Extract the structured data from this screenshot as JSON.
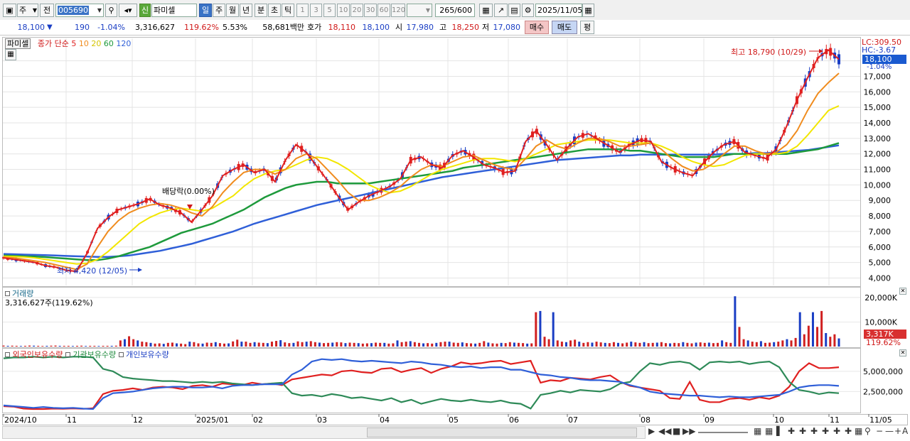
{
  "toolbar": {
    "period_selector": "주",
    "prev_label": "전",
    "code": "005690",
    "credit_badge": "신",
    "stock_name": "파미셀",
    "periods": [
      "일",
      "주",
      "월",
      "년",
      "분",
      "초",
      "틱"
    ],
    "active_period": "일",
    "intervals": [
      "1",
      "3",
      "5",
      "10",
      "20",
      "30",
      "60",
      "120"
    ],
    "count": "265",
    "count_max": "/600",
    "date": "2025/11/05"
  },
  "quote": {
    "price": "18,100",
    "change_arrow": "▼",
    "change": "190",
    "change_pct": "-1.04%",
    "volume": "3,316,627",
    "volume_ratio": "119.62%",
    "turnover_rate": "5.53%",
    "amount": "58,681백만",
    "ask_label": "호가",
    "ask": "18,110",
    "bid": "18,100",
    "open_label": "시",
    "open": "17,980",
    "high_label": "고",
    "high": "18,250",
    "low_label": "저",
    "low": "17,080",
    "buy_label": "매수",
    "sell_label": "매도",
    "eval_label": "평"
  },
  "price_pane": {
    "name_tag": "파미셀",
    "legend_prefix": "종가 단순",
    "ma_items": [
      {
        "label": "5",
        "color": "#e02020"
      },
      {
        "label": "10",
        "color": "#f08c1e"
      },
      {
        "label": "20",
        "color": "#f0e000"
      },
      {
        "label": "60",
        "color": "#1e9a3c"
      },
      {
        "label": "120",
        "color": "#2f5fd8"
      }
    ],
    "max_label": "최고 18,790 (10/29)",
    "min_label": "최저 4,420 (12/05)",
    "dividend_label": "배당락(0.00%)",
    "lc": "LC:309.50",
    "hc": "HC:-3.67",
    "price_box": "18,100",
    "price_box_pct": "-1.04%"
  },
  "volume_pane": {
    "title": "거래량",
    "value": "3,316,627주(119.62%)",
    "box": "3,317K",
    "box_pct": "119.62%"
  },
  "holdings_pane": {
    "items": [
      "외국인보유수량",
      "기관보유수량",
      "개인보유수량"
    ]
  },
  "chart_data": [
    {
      "type": "line",
      "title": "파미셀",
      "y_ticks": [
        4000,
        5000,
        6000,
        7000,
        8000,
        9000,
        10000,
        11000,
        12000,
        13000,
        14000,
        15000,
        16000,
        17000,
        18000
      ],
      "ylim": [
        3700,
        18900
      ],
      "x_ticks": [
        "2024/10",
        "11",
        "12",
        "2025/01",
        "02",
        "03",
        "04",
        "05",
        "06",
        "07",
        "08",
        "09",
        "10",
        "11",
        "11/05"
      ],
      "series": [
        {
          "name": "5",
          "values": [
            5300,
            5200,
            5100,
            5000,
            4800,
            4700,
            4500,
            4420,
            5600,
            7200,
            7900,
            8400,
            8600,
            8800,
            9100,
            8700,
            8500,
            8200,
            7600,
            8400,
            9300,
            10600,
            11000,
            11300,
            10800,
            11000,
            10200,
            11600,
            12600,
            12100,
            11200,
            10300,
            9300,
            8400,
            8900,
            9300,
            9600,
            9900,
            10400,
            11600,
            11800,
            11300,
            11100,
            11900,
            12200,
            11800,
            11300,
            11100,
            10800,
            10900,
            12800,
            13500,
            12600,
            11600,
            12400,
            13100,
            13300,
            12900,
            12500,
            12100,
            12600,
            12900,
            12800,
            11500,
            11100,
            10800,
            10600,
            11400,
            12100,
            12600,
            12800,
            12100,
            11900,
            11700,
            12300,
            13800,
            15500,
            16900,
            18200,
            18700,
            18100
          ]
        },
        {
          "name": "10",
          "values": [
            5350,
            5300,
            5200,
            5100,
            5000,
            4850,
            4700,
            4550,
            4900,
            6000,
            7000,
            7700,
            8200,
            8500,
            8700,
            8800,
            8700,
            8500,
            8200,
            8000,
            8600,
            9500,
            10200,
            10800,
            11000,
            11000,
            10700,
            11000,
            11700,
            12000,
            11700,
            11000,
            10300,
            9500,
            9000,
            9000,
            9200,
            9500,
            9900,
            10500,
            11000,
            11300,
            11200,
            11500,
            11800,
            11900,
            11600,
            11300,
            11100,
            11000,
            11700,
            12500,
            12900,
            12500,
            12300,
            12700,
            13000,
            13000,
            12800,
            12500,
            12500,
            12600,
            12700,
            12300,
            11700,
            11200,
            10900,
            11000,
            11400,
            12000,
            12500,
            12500,
            12200,
            12000,
            12100,
            12600,
            13500,
            14800,
            15900,
            16600,
            17200
          ]
        },
        {
          "name": "20",
          "values": [
            5400,
            5380,
            5350,
            5300,
            5200,
            5100,
            5000,
            4900,
            4950,
            5200,
            5700,
            6300,
            6900,
            7500,
            7900,
            8200,
            8400,
            8500,
            8400,
            8300,
            8500,
            8900,
            9300,
            9900,
            10400,
            10700,
            10900,
            11000,
            11300,
            11600,
            11800,
            11700,
            11400,
            11000,
            10500,
            10000,
            9700,
            9500,
            9600,
            9900,
            10300,
            10700,
            11000,
            11200,
            11400,
            11600,
            11700,
            11700,
            11600,
            11500,
            11700,
            12000,
            12300,
            12600,
            12700,
            12800,
            12900,
            12900,
            12900,
            12800,
            12700,
            12700,
            12700,
            12500,
            12200,
            11800,
            11500,
            11300,
            11200,
            11300,
            11600,
            11900,
            12000,
            12000,
            12000,
            12100,
            12500,
            13200,
            14000,
            14800,
            15100
          ]
        },
        {
          "name": "60",
          "values": [
            5450,
            5430,
            5400,
            5380,
            5350,
            5300,
            5250,
            5200,
            5150,
            5150,
            5250,
            5400,
            5600,
            5800,
            6000,
            6300,
            6600,
            6900,
            7100,
            7300,
            7500,
            7800,
            8100,
            8400,
            8800,
            9200,
            9500,
            9800,
            10000,
            10100,
            10200,
            10200,
            10100,
            10100,
            10100,
            10100,
            10200,
            10300,
            10400,
            10500,
            10600,
            10700,
            10800,
            10900,
            11100,
            11200,
            11300,
            11400,
            11500,
            11600,
            11700,
            11800,
            11900,
            12000,
            12100,
            12200,
            12300,
            12300,
            12300,
            12300,
            12200,
            12200,
            12100,
            12000,
            11900,
            11800,
            11800,
            11800,
            11800,
            11900,
            12000,
            12000,
            12000,
            12000,
            12000,
            12000,
            12100,
            12200,
            12300,
            12500,
            12700
          ]
        },
        {
          "name": "120",
          "values": [
            5550,
            5530,
            5510,
            5490,
            5470,
            5450,
            5420,
            5400,
            5380,
            5360,
            5360,
            5400,
            5450,
            5550,
            5650,
            5750,
            5900,
            6050,
            6200,
            6400,
            6600,
            6800,
            7000,
            7250,
            7500,
            7700,
            7900,
            8100,
            8300,
            8500,
            8700,
            8850,
            9000,
            9150,
            9300,
            9450,
            9600,
            9750,
            9900,
            10050,
            10200,
            10350,
            10500,
            10600,
            10700,
            10800,
            10900,
            11000,
            11100,
            11200,
            11300,
            11400,
            11500,
            11600,
            11650,
            11700,
            11750,
            11800,
            11850,
            11900,
            11900,
            11950,
            11950,
            11950,
            11950,
            11950,
            11950,
            11950,
            11950,
            12000,
            12000,
            12000,
            12050,
            12050,
            12100,
            12150,
            12200,
            12250,
            12350,
            12450,
            12550
          ]
        }
      ]
    },
    {
      "type": "bar",
      "title": "거래량",
      "y_ticks": [
        10000,
        20000
      ],
      "y_tick_labels": [
        "10,000K",
        "20,000K"
      ],
      "ylim": [
        0,
        22000
      ],
      "values": [
        400,
        300,
        350,
        300,
        250,
        300,
        400,
        350,
        300,
        250,
        300,
        350,
        400,
        300,
        300,
        300,
        250,
        300,
        350,
        250,
        300,
        300,
        250,
        300,
        300,
        300,
        350,
        2500,
        3000,
        4200,
        3000,
        2500,
        2000,
        1800,
        1500,
        1200,
        1300,
        1100,
        1500,
        1600,
        1300,
        1200,
        1000,
        2000,
        1800,
        1300,
        1200,
        1600,
        1500,
        1800,
        1400,
        1200,
        1300,
        2100,
        2800,
        2000,
        2000,
        1500,
        1800,
        1600,
        1500,
        1400,
        2000,
        2300,
        2600,
        1700,
        1400,
        1500,
        2100,
        1800,
        2000,
        2200,
        1800,
        1600,
        1400,
        1500,
        1600,
        1800,
        1700,
        1400,
        1600,
        1500,
        1400,
        1200,
        1300,
        1400,
        1600,
        1500,
        1500,
        1200,
        1300,
        2500,
        1800,
        2000,
        2200,
        1800,
        1500,
        1300,
        1400,
        1200,
        1500,
        1800,
        2000,
        2000,
        1600,
        1500,
        1700,
        1400,
        1300,
        1200,
        1500,
        2200,
        1600,
        1300,
        1200,
        1500,
        1400,
        1800,
        1600,
        1500,
        1400,
        1200,
        1300,
        14000,
        14500,
        4000,
        3000,
        14000,
        2500,
        2000,
        1800,
        2500,
        2800,
        2000,
        1500,
        1800,
        1600,
        2000,
        1700,
        1500,
        1400,
        1800,
        1500,
        1300,
        1600,
        2000,
        1700,
        1500,
        1800,
        1400,
        1500,
        1600,
        1800,
        1400,
        1300,
        1500,
        1400,
        1800,
        1500,
        1300,
        1600,
        1700,
        1500,
        1600,
        1400,
        1500,
        2500,
        1800,
        1500,
        20500,
        8000,
        3000,
        2500,
        2000,
        1800,
        2200,
        1500,
        1600,
        1800,
        2000,
        2500,
        3000,
        2500,
        3500,
        14000,
        5000,
        8500,
        14000,
        8000,
        14500,
        5500,
        4000,
        5000,
        3317
      ]
    },
    {
      "type": "line",
      "title": "보유수량",
      "y_ticks": [
        2500000,
        5000000
      ],
      "y_tick_labels": [
        "2,500,000",
        "5,000,000"
      ],
      "ylim": [
        0,
        7000000
      ],
      "series": [
        {
          "name": "외국인보유수량",
          "values": [
            700000,
            650000,
            400000,
            350000,
            350000,
            400000,
            380000,
            420000,
            380000,
            450000,
            2200000,
            2600000,
            2700000,
            2900000,
            2700000,
            3000000,
            3100000,
            3000000,
            2800000,
            3200000,
            3300000,
            3100000,
            3500000,
            3400000,
            3300000,
            3600000,
            3400000,
            3500000,
            3300000,
            4000000,
            4200000,
            4400000,
            4600000,
            4500000,
            5000000,
            5100000,
            4900000,
            4800000,
            5300000,
            5400000,
            4900000,
            5200000,
            5400000,
            4800000,
            5300000,
            5600000,
            6100000,
            5900000,
            6000000,
            6200000,
            6300000,
            5900000,
            6100000,
            6300000,
            3600000,
            3900000,
            3800000,
            4200000,
            4100000,
            4000000,
            4300000,
            4500000,
            3700000,
            3200000,
            3000000,
            2800000,
            2600000,
            1700000,
            1600000,
            3700000,
            1500000,
            1200000,
            1200000,
            1600000,
            1700000,
            1500000,
            1800000,
            1600000,
            2000000,
            3100000,
            5000000,
            6000000,
            5400000,
            5400000,
            5500000
          ]
        },
        {
          "name": "기관보유수량",
          "values": [
            6600000,
            6700000,
            6700000,
            6800000,
            6700000,
            6800000,
            6700000,
            6800000,
            6800000,
            6700000,
            5300000,
            5000000,
            4300000,
            4100000,
            4000000,
            3900000,
            3800000,
            3800000,
            3700000,
            3600000,
            3700000,
            3600000,
            3700000,
            3500000,
            3400000,
            3300000,
            3400000,
            3500000,
            3600000,
            2300000,
            2000000,
            2100000,
            1900000,
            2200000,
            2000000,
            1700000,
            1800000,
            1600000,
            1400000,
            1700000,
            1200000,
            1500000,
            1000000,
            1300000,
            1600000,
            1400000,
            1300000,
            1500000,
            1300000,
            1200000,
            1400000,
            1100000,
            1000000,
            400000,
            2100000,
            2300000,
            2600000,
            2400000,
            2700000,
            2600000,
            2500000,
            2800000,
            3500000,
            3700000,
            5000000,
            6000000,
            5800000,
            6100000,
            6200000,
            6000000,
            5200000,
            6100000,
            6200000,
            6100000,
            6200000,
            5900000,
            6100000,
            6200000,
            5500000,
            3700000,
            2700000,
            2500000,
            2200000,
            2400000,
            2300000
          ]
        },
        {
          "name": "개인보유수량",
          "values": [
            800000,
            700000,
            600000,
            500000,
            600000,
            500000,
            450000,
            500000,
            400000,
            350000,
            1700000,
            2300000,
            2400000,
            2500000,
            2700000,
            2900000,
            3000000,
            3100000,
            3100000,
            3000000,
            3000000,
            3100000,
            2900000,
            3200000,
            3300000,
            3300000,
            3400000,
            3400000,
            3400000,
            4600000,
            5200000,
            6200000,
            6500000,
            6400000,
            6500000,
            6300000,
            6200000,
            6300000,
            6200000,
            6100000,
            6000000,
            6200000,
            6100000,
            5900000,
            5800000,
            5600000,
            5500000,
            5600000,
            5400000,
            5500000,
            5500000,
            5200000,
            5200000,
            4900000,
            4600000,
            4500000,
            4300000,
            4200000,
            4000000,
            3900000,
            3900000,
            3800000,
            3700000,
            3300000,
            3000000,
            2500000,
            2300000,
            2200000,
            2100000,
            2000000,
            2000000,
            1900000,
            1800000,
            1900000,
            1800000,
            1800000,
            1900000,
            2000000,
            2100000,
            2500000,
            3000000,
            3200000,
            3300000,
            3300000,
            3200000
          ]
        }
      ]
    }
  ]
}
